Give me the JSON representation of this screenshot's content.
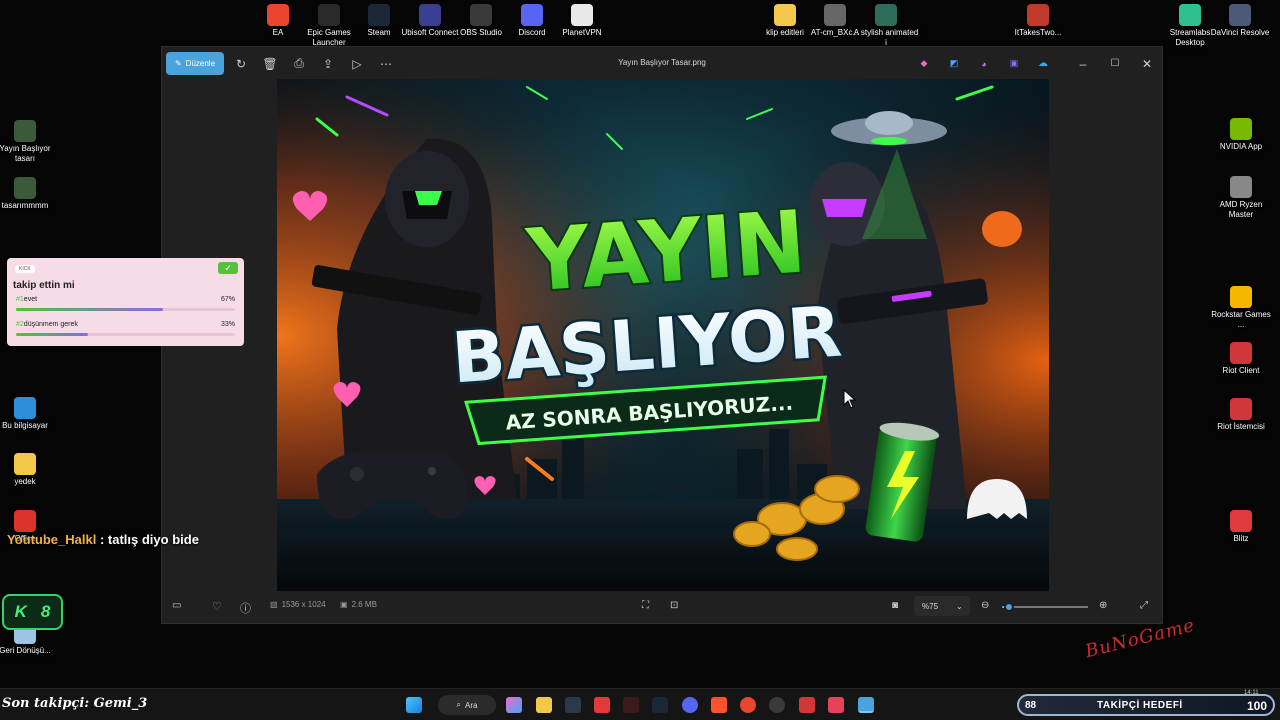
{
  "desktop": {
    "top_icons": [
      {
        "label": "EA",
        "color": "#e8452c",
        "icon": "ea-icon"
      },
      {
        "label": "Epic Games Launcher",
        "color": "#2a2a2a",
        "icon": "epic-games-icon"
      },
      {
        "label": "Steam",
        "color": "#1b2838",
        "icon": "steam-icon"
      },
      {
        "label": "Ubisoft Connect",
        "color": "#3a3f8f",
        "icon": "ubisoft-icon"
      },
      {
        "label": "OBS Studio",
        "color": "#3a3a3a",
        "icon": "obs-icon"
      },
      {
        "label": "Discord",
        "color": "#5865f2",
        "icon": "discord-icon"
      },
      {
        "label": "PlanetVPN",
        "color": "#e8e8e8",
        "icon": "planetvpn-icon"
      },
      {
        "label": "klip editleri",
        "color": "#f3c74a",
        "icon": "folder-icon"
      },
      {
        "label": "AT-cm_BXc...",
        "color": "#666666",
        "icon": "image-file-icon"
      },
      {
        "label": "A stylish animated i",
        "color": "#2d6b5a",
        "icon": "image-file-icon"
      },
      {
        "label": "ItTakesTwo...",
        "color": "#c0392b",
        "icon": "archive-icon"
      },
      {
        "label": "Streamlabs Desktop",
        "color": "#2ec18e",
        "icon": "streamlabs-icon"
      },
      {
        "label": "DaVinci Resolve",
        "color": "#4a5a78",
        "icon": "davinci-icon"
      }
    ],
    "left_icons": [
      {
        "label": "Yayın Başlıyor tasarı",
        "color": "#3a5a3a",
        "icon": "image-file-icon"
      },
      {
        "label": "tasarımmmm",
        "color": "#3a5a3a",
        "icon": "image-file-icon"
      },
      {
        "label": "Bu bilgisayar",
        "color": "#2f8ed8",
        "icon": "computer-icon"
      },
      {
        "label": "yedek",
        "color": "#f3c74a",
        "icon": "folder-icon"
      },
      {
        "label": "Office",
        "color": "#d9332b",
        "icon": "office-icon"
      },
      {
        "label": "Geri Dönüşü...",
        "color": "#9bc4e6",
        "icon": "recycle-bin-icon"
      }
    ],
    "right_icons": [
      {
        "label": "NVIDIA App",
        "color": "#76b900",
        "icon": "nvidia-icon"
      },
      {
        "label": "AMD Ryzen Master",
        "color": "#888888",
        "icon": "amd-icon"
      },
      {
        "label": "Rockstar Games ...",
        "color": "#f5b800",
        "icon": "rockstar-icon"
      },
      {
        "label": "Riot Client",
        "color": "#d13639",
        "icon": "riot-icon"
      },
      {
        "label": "Riot İstemcisi",
        "color": "#d13639",
        "icon": "riot-icon"
      },
      {
        "label": "Blitz",
        "color": "#e03a3a",
        "icon": "blitz-icon"
      }
    ]
  },
  "photos": {
    "edit_label": "Düzenle",
    "title": "Yayın Başlıyor Tasar.png",
    "dimensions": "1536 x 1024",
    "size": "2.6 MB",
    "zoom": "%75",
    "zoom_fraction": 0.08
  },
  "poster": {
    "line1": "YAYIN",
    "line2": "BAŞLIYOR",
    "banner": "AZ SONRA BAŞLIYORUZ..."
  },
  "poll": {
    "badge": "KICK",
    "question": "takip ettin mi",
    "options": [
      {
        "num": "#1",
        "label": "evet",
        "percent": "67%",
        "value": 0.67
      },
      {
        "num": "#2",
        "label": "düşünmem gerek",
        "percent": "33%",
        "value": 0.33
      }
    ]
  },
  "chat": {
    "user": "Youtube_Halkl",
    "message": ": tatlış diyo bide"
  },
  "kick_badge": {
    "left": "K",
    "right": "8"
  },
  "watermark": "BuNoGame",
  "taskbar": {
    "last_follower": "Son takipçi: Gemi_3",
    "search_label": "Ara",
    "goal_current": "88",
    "goal_label": "TAKİPÇİ HEDEFİ",
    "goal_target": "100",
    "clock": "14:11"
  }
}
